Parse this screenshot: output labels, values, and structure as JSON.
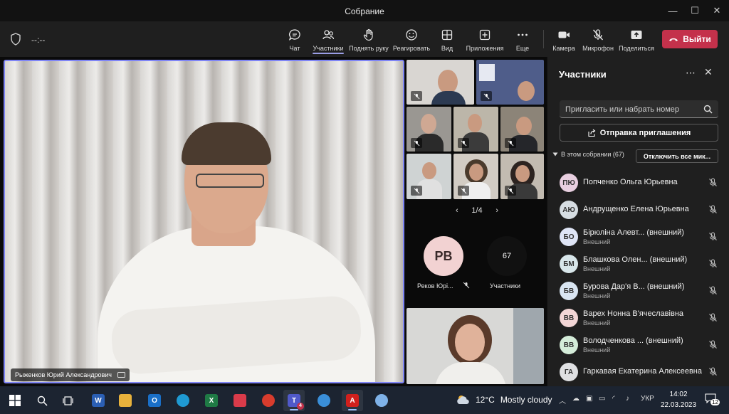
{
  "window": {
    "title": "Собрание",
    "minimize": "—",
    "maximize": "☐",
    "close": "✕"
  },
  "toolbar": {
    "timer": "--:--",
    "chat": "Чат",
    "people": "Участники",
    "raise_hand": "Поднять руку",
    "react": "Реагировать",
    "view": "Вид",
    "apps": "Приложения",
    "more": "Еще",
    "camera": "Камера",
    "mic": "Микрофон",
    "share": "Поделиться",
    "leave": "Выйти"
  },
  "main_video": {
    "name": "Рыженков Юрий Александрович"
  },
  "gallery": {
    "pager": "1/4",
    "avatar_initials": "PB",
    "avatar_name": "Реков Юрі...",
    "count": "67",
    "count_label": "Участники"
  },
  "panel": {
    "title": "Участники",
    "invite_placeholder": "Пригласить или набрать номер",
    "send_invite": "Отправка приглашения",
    "section": "В этом собрании (67)",
    "mute_all": "Отключить все мик...",
    "participants": [
      {
        "initials": "ПЮ",
        "name": "Попченко Ольга Юрьевна",
        "sub": "",
        "color": "#e8cfe0"
      },
      {
        "initials": "АЮ",
        "name": "Андрущенко Елена Юрьевна",
        "sub": "",
        "color": "#d6dde2"
      },
      {
        "initials": "БО",
        "name": "Бірюліна Алевт...  (внешний)",
        "sub": "Внешний",
        "color": "#dfe5f6"
      },
      {
        "initials": "БМ",
        "name": "Блашкова Олен...  (внешний)",
        "sub": "Внешний",
        "color": "#d8e6ea"
      },
      {
        "initials": "БВ",
        "name": "Бурова Дар'я В...  (внешний)",
        "sub": "Внешний",
        "color": "#d9e5f2"
      },
      {
        "initials": "ВВ",
        "name": "Варех Нонна В'ячеславівна",
        "sub": "Внешний",
        "color": "#f3d6d6"
      },
      {
        "initials": "ВВ",
        "name": "Володченкова ...  (внешний)",
        "sub": "Внешний",
        "color": "#d4ecd9"
      },
      {
        "initials": "ГА",
        "name": "Гаркавая Екатерина Алексеевна",
        "sub": "",
        "color": "#dfe0e2"
      }
    ]
  },
  "taskbar": {
    "temp": "12°C",
    "weather": "Mostly cloudy",
    "lang": "УКР",
    "time": "14:02",
    "date": "22.03.2023",
    "notifications": "12",
    "teams_badge": "4"
  }
}
